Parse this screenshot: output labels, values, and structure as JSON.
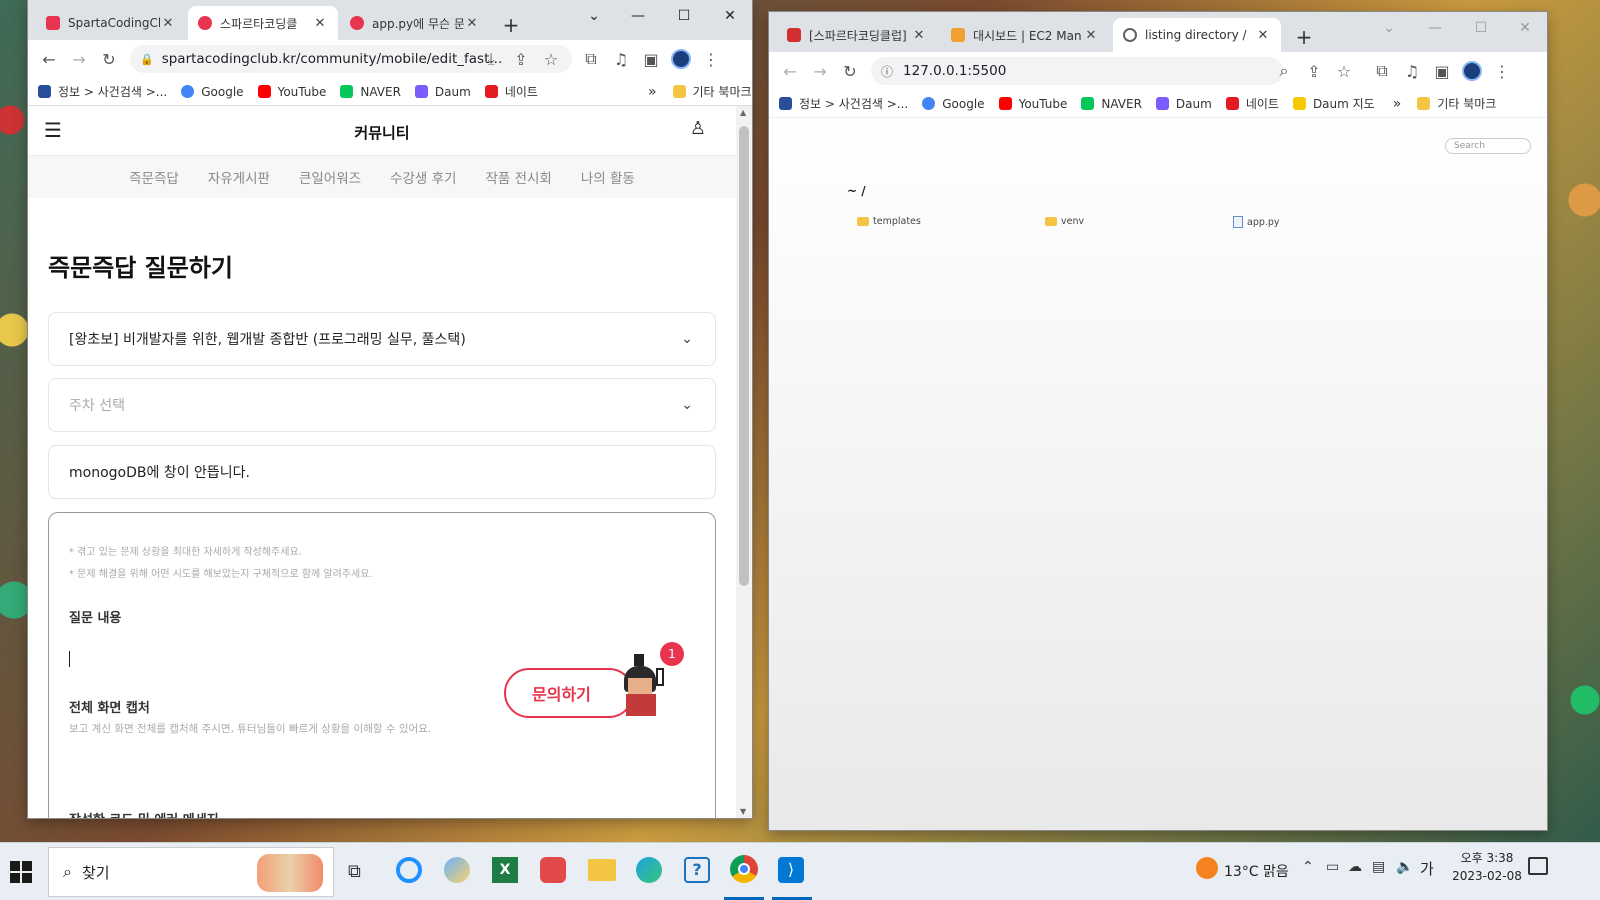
{
  "left_browser": {
    "tabs": [
      {
        "title": "SpartaCodingClu",
        "color": "#e8344e"
      },
      {
        "title": "스파르타코딩클",
        "color": "#e8344e"
      },
      {
        "title": "app.py에 무슨 문",
        "color": "#e8344e"
      }
    ],
    "url": "spartacodingclub.kr/community/mobile/edit_fast...",
    "bookmarks": [
      "정보 > 사건검색 >...",
      "Google",
      "YouTube",
      "NAVER",
      "Daum",
      "네이트"
    ],
    "more": "»",
    "other_bookmarks": "기타 북마크",
    "page": {
      "header_title": "커뮤니티",
      "nav": [
        "즉문즉답",
        "자유게시판",
        "큰일어워즈",
        "수강생 후기",
        "작품 전시회",
        "나의 활동"
      ],
      "heading": "즉문즉답 질문하기",
      "course_select": "[왕초보] 비개발자를 위한, 웹개발 종합반 (프로그래밍 실무, 풀스택)",
      "week_placeholder": "주차 선택",
      "title_value": "monogoDB에 창이 안뜹니다.",
      "hint1": "* 겪고 있는 문제 상황을 최대한 자세하게 작성해주세요.",
      "hint2": "* 문제 해결을 위해 어떤 시도를 해보았는지 구체적으로 함께 알려주세요.",
      "section_question": "질문 내용",
      "section_capture": "전체 화면 캡처",
      "capture_desc": "보고 계신 화면 전체를 캡처해 주시면, 튜터님들이 빠르게 상황을 이해할 수 있어요.",
      "section_code": "작성한 코드 및 에러 메세지",
      "inquiry_button": "문의하기",
      "badge": "1"
    }
  },
  "right_browser": {
    "tabs": [
      {
        "title": "[스파르타코딩클럽]",
        "color": "#d32f2f"
      },
      {
        "title": "대시보드 | EC2 Man",
        "color": "#f0a030"
      },
      {
        "title": "listing directory /",
        "color": "#5f6368"
      }
    ],
    "url": "127.0.0.1:5500",
    "bookmarks": [
      "정보 > 사건검색 >...",
      "Google",
      "YouTube",
      "NAVER",
      "Daum",
      "네이트",
      "Daum 지도"
    ],
    "more": "»",
    "other_bookmarks": "기타 북마크",
    "page": {
      "search_placeholder": "Search",
      "path": "~ /",
      "files": [
        {
          "name": "templates",
          "icon": "folder-icon"
        },
        {
          "name": "venv",
          "icon": "folder-icon"
        },
        {
          "name": "app.py",
          "icon": "code-file-icon"
        }
      ]
    }
  },
  "taskbar": {
    "search_label": "찾기",
    "weather": "13°C 맑음",
    "ime": "가",
    "time": "오후 3:38",
    "date": "2023-02-08"
  }
}
